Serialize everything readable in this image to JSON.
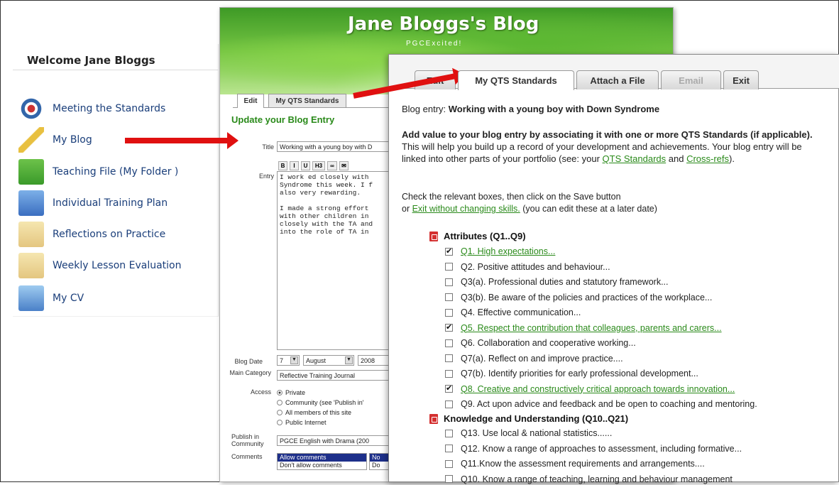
{
  "sidebar": {
    "welcome": "Welcome Jane Bloggs",
    "items": [
      {
        "label": "Meeting the Standards",
        "icon": "target-icon"
      },
      {
        "label": "My Blog",
        "icon": "pencil-icon"
      },
      {
        "label": "Teaching File (My Folder )",
        "icon": "folder-icon"
      },
      {
        "label": "Individual Training Plan",
        "icon": "document-icon"
      },
      {
        "label": "Reflections on Practice",
        "icon": "notes-icon"
      },
      {
        "label": "Weekly Lesson Evaluation",
        "icon": "notes-icon"
      },
      {
        "label": "My CV",
        "icon": "cv-card-icon"
      }
    ]
  },
  "back": {
    "title": "Jane Bloggs's Blog",
    "subtitle": "PGCExcited!",
    "tabs": [
      "Edit",
      "My QTS Standards"
    ],
    "heading": "Update your Blog Entry",
    "title_label": "Title",
    "title_value": "Working with a young boy with D",
    "toolbar": [
      "B",
      "I",
      "U",
      "H3",
      "∞",
      "✉"
    ],
    "entry_label": "Entry",
    "entry_text": "I work ed closely with \nSyndrome this week. I f\nalso very rewarding.\n\nI made a strong effort \nwith other children in \nclosely with the TA and\ninto the role of TA in ",
    "blog_date_label": "Blog Date",
    "date_day": "7",
    "date_month": "August",
    "date_year": "2008",
    "main_category_label": "Main Category",
    "main_category": "Reflective Training Journal",
    "access_label": "Access",
    "access_options": [
      "Private",
      "Community (see 'Publish in'",
      "All members of this site",
      "Public Internet"
    ],
    "publish_label": "Publish in Community",
    "publish_value": "PGCE English with Drama (200",
    "comments_label": "Comments",
    "comments_options": [
      "Allow comments",
      "Don't allow comments"
    ],
    "comments_b_options": [
      "No",
      "Do"
    ]
  },
  "front": {
    "tabs": [
      {
        "label": "Edit",
        "state": "normal"
      },
      {
        "label": "My QTS Standards",
        "state": "active"
      },
      {
        "label": "Attach a File",
        "state": "normal"
      },
      {
        "label": "Email",
        "state": "disabled"
      },
      {
        "label": "Exit",
        "state": "normal"
      }
    ],
    "blog_entry_prefix": "Blog entry: ",
    "blog_entry_title": "Working with a young boy with Down Syndrome",
    "intro_bold": "Add value to your blog entry by associating it with one or more QTS Standards (if applicable).",
    "intro_rest": " This will help you build up a record of your development and achievements. Your blog entry will be linked into other parts of your portfolio (see: your ",
    "link_qts": "QTS Standards",
    "intro_and": " and ",
    "link_cross": "Cross-refs",
    "intro_end": ").",
    "check_line1": "Check the relevant boxes, then click on the Save button",
    "check_or": "or ",
    "check_link": "Exit without changing skills.",
    "check_tail": " (you can edit these at a later date)",
    "cat1": "Attributes (Q1..Q9)",
    "items1": [
      {
        "text": "Q1. High expectations...",
        "checked": true
      },
      {
        "text": "Q2. Positive attitudes and behaviour...",
        "checked": false
      },
      {
        "text": "Q3(a). Professional duties and statutory framework...",
        "checked": false
      },
      {
        "text": "Q3(b). Be aware of the policies and practices of the workplace...",
        "checked": false
      },
      {
        "text": "Q4. Effective communication...",
        "checked": false
      },
      {
        "text": "Q5. Respect the contribution that colleagues, parents and carers...",
        "checked": true
      },
      {
        "text": "Q6. Collaboration and cooperative working...",
        "checked": false
      },
      {
        "text": "Q7(a). Reflect on and improve practice....",
        "checked": false
      },
      {
        "text": "Q7(b). Identify priorities for early professional development...",
        "checked": false
      },
      {
        "text": "Q8. Creative and constructively critical approach towards innovation...",
        "checked": true
      },
      {
        "text": "Q9. Act upon advice and feedback and be open to coaching and mentoring.",
        "checked": false
      }
    ],
    "cat2": "Knowledge and Understanding (Q10..Q21)",
    "items2": [
      {
        "text": "Q13. Use local & national statistics......",
        "checked": false
      },
      {
        "text": "Q12. Know a range of approaches to assessment, including formative...",
        "checked": false
      },
      {
        "text": "Q11.Know the assessment requirements and arrangements....",
        "checked": false
      },
      {
        "text": "Q10. Know a range of teaching, learning and behaviour management",
        "checked": false
      }
    ]
  }
}
